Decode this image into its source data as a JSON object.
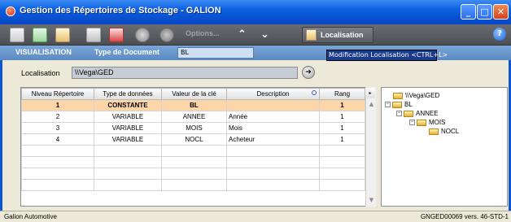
{
  "window": {
    "title": "Gestion des Répertoires de Stockage - GALION",
    "controls": {
      "minimize": "_",
      "maximize": "□",
      "close": "✕"
    }
  },
  "toolbar": {
    "options_label": "Options...",
    "up_arrow": "⌃",
    "down_arrow": "⌄",
    "localisation_label": "Localisation",
    "help_label": "?"
  },
  "subbar": {
    "visualisation_label": "VISUALISATION",
    "type_document_label": "Type de Document",
    "type_document_value": "BL"
  },
  "tooltip": {
    "text": "Modification Localisation <CTRL+L>"
  },
  "localisation": {
    "label": "Localisation",
    "value": "\\\\Vega\\GED",
    "go_symbol": "➔"
  },
  "grid": {
    "columns": [
      "Niveau Répertoire",
      "Type de données",
      "Valeur de la clé",
      "Description",
      "Rang"
    ],
    "menu_symbol": "▸",
    "rows": [
      [
        "1",
        "CONSTANTE",
        "BL",
        "",
        "1"
      ],
      [
        "2",
        "VARIABLE",
        "ANNEE",
        "Année",
        "1"
      ],
      [
        "3",
        "VARIABLE",
        "MOIS",
        "Mois",
        "1"
      ],
      [
        "4",
        "VARIABLE",
        "NOCL",
        "Acheteur",
        "1"
      ]
    ],
    "selected_row": 0,
    "scroll_up": "▲",
    "scroll_down": "▼"
  },
  "tree": {
    "nodes": [
      {
        "label": "\\\\Vega\\GED",
        "expander": ""
      },
      {
        "label": "BL",
        "expander": "⊟"
      },
      {
        "label": "ANNEE",
        "expander": "⊟"
      },
      {
        "label": "MOIS",
        "expander": "⊟"
      },
      {
        "label": "NOCL",
        "expander": ""
      }
    ]
  },
  "status": {
    "left": "Galion Automotive",
    "right": "GNGED00069 vers. 46-STD-1"
  },
  "colors": {
    "title_bar": "#0a5fe0",
    "toolbar": "#55585c",
    "subbar": "#6b97cc",
    "selected_row": "#fcd6a8",
    "tooltip": "#1a3a8a"
  }
}
